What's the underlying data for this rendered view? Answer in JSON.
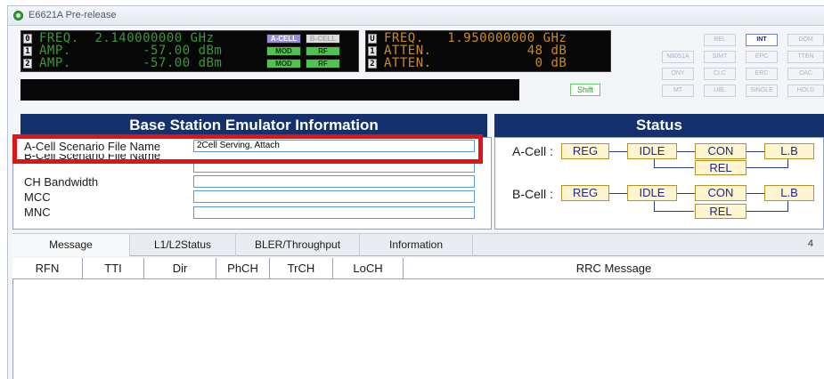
{
  "window": {
    "title": "E6621A Pre-release"
  },
  "lcd_left": {
    "rows": [
      {
        "channel": "0",
        "text": "FREQ.  2.140000000 GHz"
      },
      {
        "channel": "1",
        "text": "AMP.         -57.00 dBm"
      },
      {
        "channel": "2",
        "text": "AMP.         -57.00 dBm"
      }
    ],
    "tags": {
      "acell": "A-CELL",
      "bcell": "B-CELL",
      "mod": "MOD",
      "rf": "RF"
    }
  },
  "lcd_right": {
    "rows": [
      {
        "channel": "U",
        "text": "FREQ.   1.950000000 GHz"
      },
      {
        "channel": "1",
        "text": "ATTEN.            48 dB"
      },
      {
        "channel": "2",
        "text": "ATTEN.             0 dB"
      }
    ]
  },
  "shift_label": "Shift",
  "panel_buttons": {
    "row1": [
      "REL",
      "INT",
      "DOM"
    ],
    "row2": [
      "N6051A",
      "SIMT",
      "EPC",
      "TTEN"
    ],
    "row3": [
      "ONY",
      "CLC",
      "ERC",
      "CAC"
    ],
    "row4": [
      "MT",
      "UBL",
      "SINGLE",
      "HOLD"
    ]
  },
  "info_panel": {
    "title": "Base Station Emulator Information",
    "fields": [
      {
        "label": "A-Cell Scenario File Name",
        "value": "2Cell Serving, Attach"
      },
      {
        "label": "B-Cell Scenario File Name",
        "value": ""
      },
      {
        "label": "CH Bandwidth",
        "value": ""
      },
      {
        "label": "MCC",
        "value": ""
      },
      {
        "label": "MNC",
        "value": ""
      }
    ]
  },
  "status_panel": {
    "title": "Status",
    "a_cell_label": "A-Cell :",
    "b_cell_label": "B-Cell :",
    "states": {
      "reg": "REG",
      "idle": "IDLE",
      "con": "CON",
      "lb": "L.B",
      "rel": "REL"
    }
  },
  "tabs": [
    "Message",
    "L1/L2Status",
    "BLER/Throughput",
    "Information"
  ],
  "tab_scroll": "4",
  "columns": [
    "RFN",
    "TTI",
    "Dir",
    "PhCH",
    "TrCH",
    "LoCH",
    "RRC Message"
  ]
}
